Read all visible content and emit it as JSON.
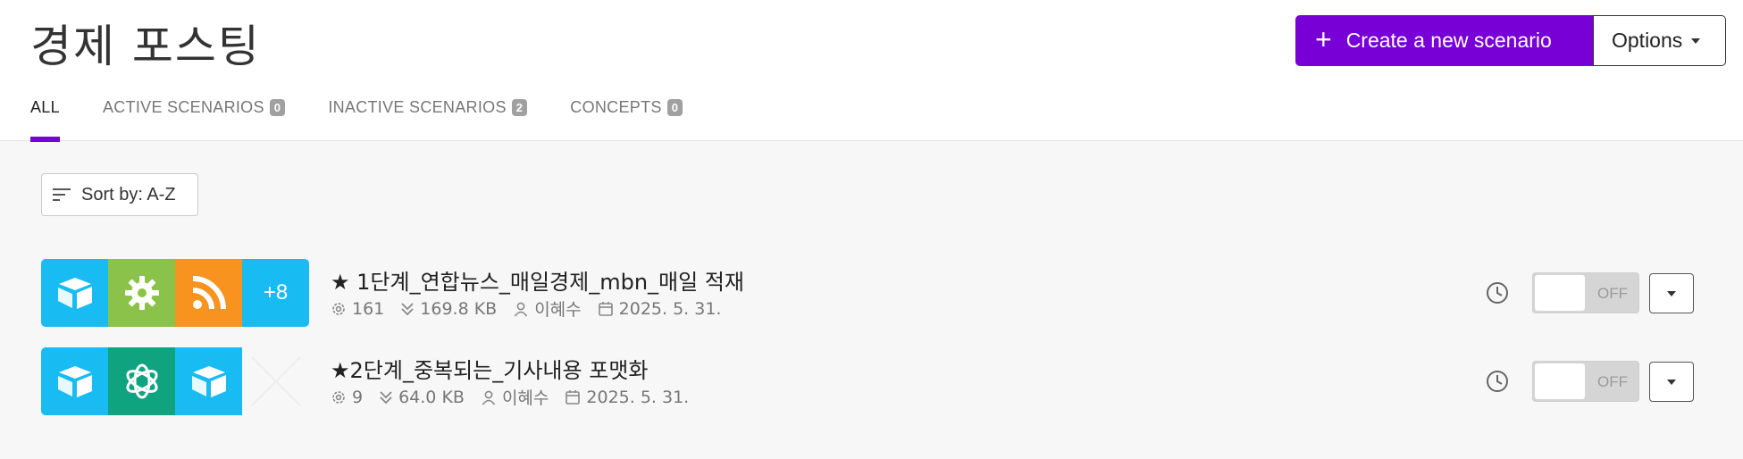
{
  "page": {
    "title": "경제 포스팅"
  },
  "header": {
    "create_label": "Create a new scenario",
    "options_label": "Options"
  },
  "tabs": [
    {
      "label": "ALL",
      "count": null,
      "active": true
    },
    {
      "label": "ACTIVE SCENARIOS",
      "count": "0",
      "active": false
    },
    {
      "label": "INACTIVE SCENARIOS",
      "count": "2",
      "active": false
    },
    {
      "label": "CONCEPTS",
      "count": "0",
      "active": false
    }
  ],
  "sort": {
    "label": "Sort by: A-Z"
  },
  "scenarios": [
    {
      "name": "★ 1단계_연합뉴스_매일경제_mbn_매일 적재",
      "operations": "161",
      "data_size": "169.8 KB",
      "owner": "이혜수",
      "date": "2025. 5. 31.",
      "more_modules": "+8",
      "status": "OFF",
      "modules": [
        "airtable-icon",
        "tools-gear-icon",
        "rss-icon"
      ]
    },
    {
      "name": "★2단계_중복되는_기사내용 포맷화",
      "operations": "9",
      "data_size": "64.0 KB",
      "owner": "이혜수",
      "date": "2025. 5. 31.",
      "status": "OFF",
      "modules": [
        "airtable-icon",
        "openai-icon",
        "airtable-icon",
        "empty-module-icon"
      ]
    }
  ],
  "colors": {
    "accent": "#7800d6",
    "airtable_blue": "#18bcf2",
    "tools_green": "#8bc34a",
    "rss_orange": "#f7931e",
    "openai_teal": "#10a37f"
  }
}
